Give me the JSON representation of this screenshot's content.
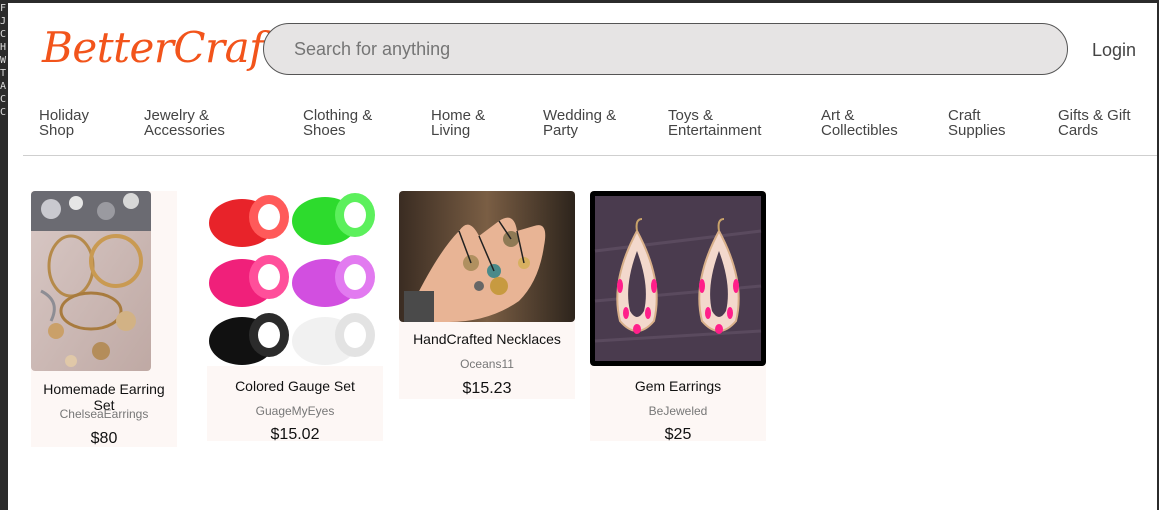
{
  "header": {
    "logo": "BetterCraft",
    "search_placeholder": "Search for anything",
    "login": "Login"
  },
  "categories": [
    {
      "line1": "Holiday",
      "line2": "Shop"
    },
    {
      "line1": "Jewelry &",
      "line2": "Accessories"
    },
    {
      "line1": "Clothing &",
      "line2": "Shoes"
    },
    {
      "line1": "Home &",
      "line2": "Living"
    },
    {
      "line1": "Wedding &",
      "line2": "Party"
    },
    {
      "line1": "Toys &",
      "line2": "Entertainment"
    },
    {
      "line1": "Art &",
      "line2": "Collectibles"
    },
    {
      "line1": "Craft",
      "line2": "Supplies"
    },
    {
      "line1": "Gifts & Gift",
      "line2": "Cards"
    }
  ],
  "products": [
    {
      "title": "Homemade Earring Set",
      "seller": "ChelseaEarrings",
      "price": "$80"
    },
    {
      "title": "Colored Gauge Set",
      "seller": "GuageMyEyes",
      "price": "$15.02"
    },
    {
      "title": "HandCrafted Necklaces",
      "seller": "Oceans11",
      "price": "$15.23"
    },
    {
      "title": "Gem Earrings",
      "seller": "BeJeweled",
      "price": "$25"
    }
  ],
  "left_strip_letters": [
    "F",
    "J",
    "C",
    "H",
    "W",
    "T",
    "A",
    "C",
    "C"
  ]
}
